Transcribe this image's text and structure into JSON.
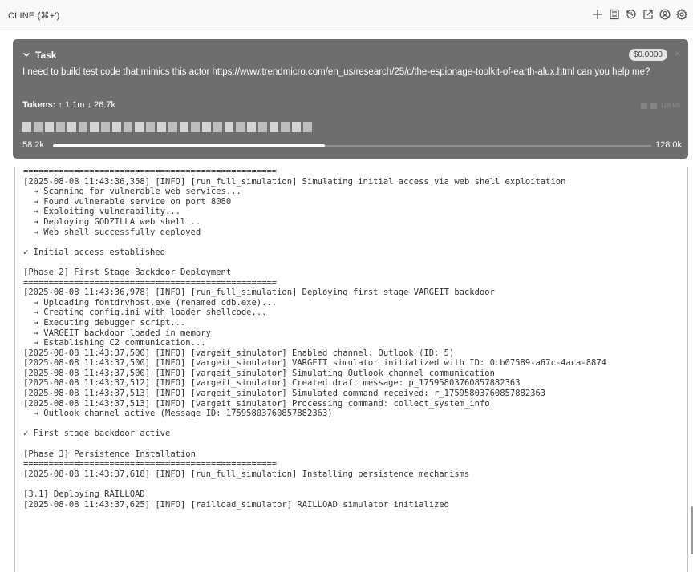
{
  "window": {
    "title": "CLINE (⌘+')"
  },
  "toolbar": {
    "icons": [
      "plus-icon",
      "history-list-icon",
      "history-icon",
      "popout-icon",
      "account-icon",
      "settings-icon"
    ]
  },
  "task": {
    "label": "Task",
    "cost": "$0.0000",
    "close": "×",
    "message": "I need to build test code that mimics this actor https://www.trendmicro.com/en_us/research/25/c/the-espionage-toolkit-of-earth-alux.html  can you help me?",
    "tokens_label": "Tokens:",
    "tokens_up": "↑ 1.1m",
    "tokens_down": "↓ 26.7k",
    "cache_size": "126 kB",
    "context_used": "58.2k",
    "context_max": "128.0k",
    "context_fraction": 0.455
  },
  "console": {
    "lines": [
      "==================================================",
      "[2025-08-08 11:43:36,358] [INFO] [run_full_simulation] Simulating initial access via web shell exploitation",
      "  → Scanning for vulnerable web services...",
      "  → Found vulnerable service on port 8080",
      "  → Exploiting vulnerability...",
      "  → Deploying GODZILLA web shell...",
      "  → Web shell successfully deployed",
      "",
      "✓ Initial access established",
      "",
      "[Phase 2] First Stage Backdoor Deployment",
      "==================================================",
      "[2025-08-08 11:43:36,978] [INFO] [run_full_simulation] Deploying first stage VARGEIT backdoor",
      "  → Uploading fontdrvhost.exe (renamed cdb.exe)...",
      "  → Creating config.ini with loader shellcode...",
      "  → Executing debugger script...",
      "  → VARGEIT backdoor loaded in memory",
      "  → Establishing C2 communication...",
      "[2025-08-08 11:43:37,500] [INFO] [vargeit_simulator] Enabled channel: Outlook (ID: 5)",
      "[2025-08-08 11:43:37,500] [INFO] [vargeit_simulator] VARGEIT simulator initialized with ID: 0cb07589-a67c-4aca-8874",
      "[2025-08-08 11:43:37,500] [INFO] [vargeit_simulator] Simulating Outlook channel communication",
      "[2025-08-08 11:43:37,512] [INFO] [vargeit_simulator] Created draft message: p_17595803760857882363",
      "[2025-08-08 11:43:37,513] [INFO] [vargeit_simulator] Simulated command received: r_17595803760857882363",
      "[2025-08-08 11:43:37,513] [INFO] [vargeit_simulator] Processing command: collect_system_info",
      "  → Outlook channel active (Message ID: 17595803760857882363)",
      "",
      "✓ First stage backdoor active",
      "",
      "[Phase 3] Persistence Installation",
      "==================================================",
      "[2025-08-08 11:43:37,618] [INFO] [run_full_simulation] Installing persistence mechanisms",
      "",
      "[3.1] Deploying RAILLOAD",
      "[2025-08-08 11:43:37,625] [INFO] [railload_simulator] RAILLOAD simulator initialized"
    ]
  }
}
